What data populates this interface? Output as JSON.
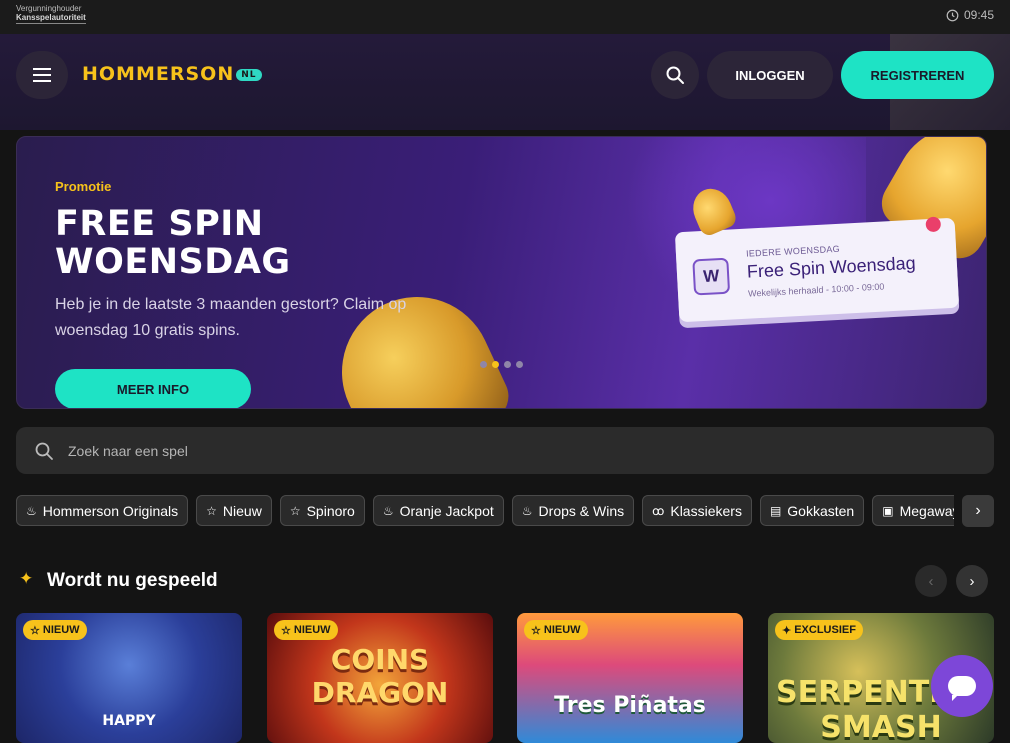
{
  "topbar": {
    "regulator_line1": "Vergunninghouder",
    "regulator_line2": "Kansspelautoriteit",
    "time": "09:45"
  },
  "header": {
    "logo_text": "HOMMERSON",
    "logo_badge": "NL",
    "login_label": "INLOGGEN",
    "register_label": "REGISTREREN"
  },
  "banner": {
    "tag": "Promotie",
    "title": "FREE SPIN WOENSDAG",
    "description": "Heb je in de laatste 3 maanden gestort? Claim op woensdag 10 gratis spins.",
    "button_label": "MEER INFO",
    "card_small": "IEDERE WOENSDAG",
    "card_title": "Free Spin Woensdag",
    "card_sub": "Wekelijks herhaald - 10:00 - 09:00",
    "card_letter": "W",
    "slide_count": 4,
    "active_slide": 2
  },
  "search": {
    "placeholder": "Zoek naar een spel"
  },
  "categories": [
    {
      "label": "Hommerson Originals",
      "icon": "flame-icon"
    },
    {
      "label": "Nieuw",
      "icon": "star-icon"
    },
    {
      "label": "Spinoro",
      "icon": "star-icon"
    },
    {
      "label": "Oranje Jackpot",
      "icon": "flame-icon"
    },
    {
      "label": "Drops & Wins",
      "icon": "flame-icon"
    },
    {
      "label": "Klassiekers",
      "icon": "cherries-icon"
    },
    {
      "label": "Gokkasten",
      "icon": "slot-icon"
    },
    {
      "label": "Megaways",
      "icon": "megaways-icon"
    }
  ],
  "section": {
    "title": "Wordt nu gespeeld"
  },
  "games": [
    {
      "tag": "NIEUW",
      "title": "HAPPY"
    },
    {
      "tag": "NIEUW",
      "title": "COINS DRAGON"
    },
    {
      "tag": "NIEUW",
      "title": "Tres Piñatas"
    },
    {
      "tag": "EXCLUSIEF",
      "title": "SERPENTINE SMASH"
    }
  ],
  "colors": {
    "accent_teal": "#1ee3c5",
    "accent_yellow": "#f7c21b",
    "chat_purple": "#7d47d8"
  }
}
